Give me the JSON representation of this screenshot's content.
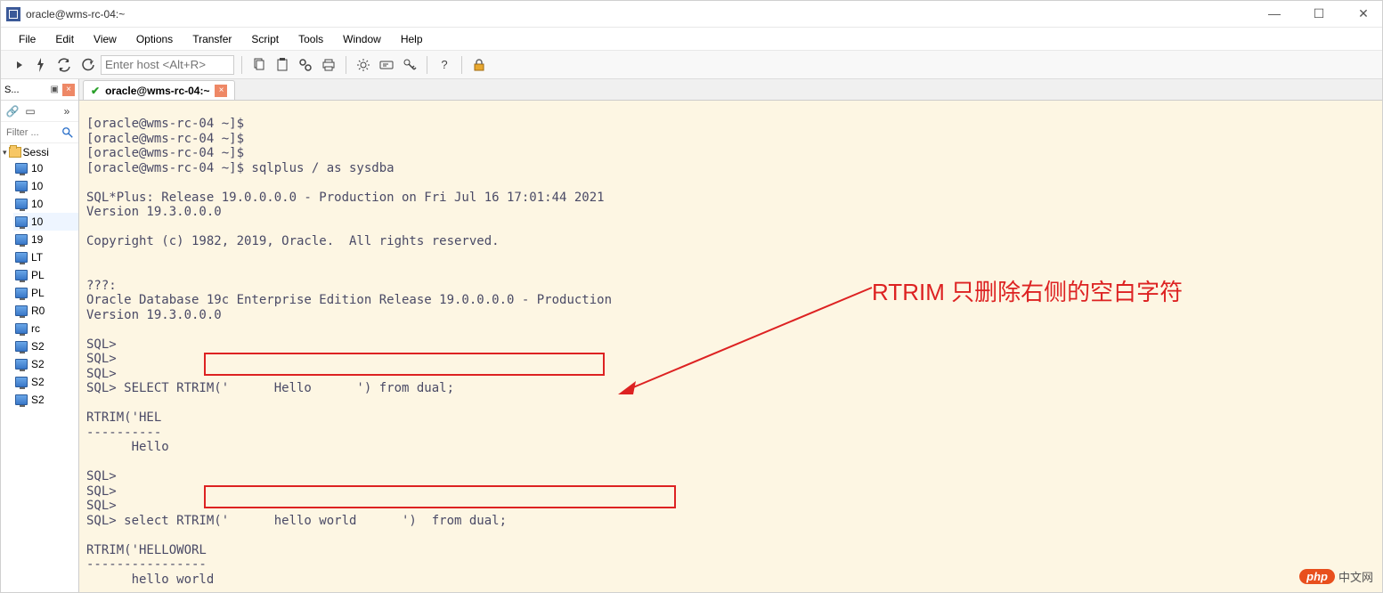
{
  "titlebar": {
    "title": "oracle@wms-rc-04:~"
  },
  "menu": {
    "file": "File",
    "edit": "Edit",
    "view": "View",
    "options": "Options",
    "transfer": "Transfer",
    "script": "Script",
    "tools": "Tools",
    "window": "Window",
    "help": "Help"
  },
  "toolbar": {
    "host_placeholder": "Enter host <Alt+R>"
  },
  "sidebar": {
    "tab_label": "S...",
    "filter_placeholder": "Filter ...",
    "root_label": "Sessi",
    "items": [
      {
        "label": "10"
      },
      {
        "label": "10"
      },
      {
        "label": "10"
      },
      {
        "label": "10"
      },
      {
        "label": "19"
      },
      {
        "label": "LT"
      },
      {
        "label": "PL"
      },
      {
        "label": "PL"
      },
      {
        "label": "R0"
      },
      {
        "label": "rc"
      },
      {
        "label": "S2"
      },
      {
        "label": "S2"
      },
      {
        "label": "S2"
      },
      {
        "label": "S2"
      }
    ],
    "selected_index": 3
  },
  "tab": {
    "title": "oracle@wms-rc-04:~"
  },
  "terminal": {
    "lines": [
      "[oracle@wms-rc-04 ~]$",
      "[oracle@wms-rc-04 ~]$",
      "[oracle@wms-rc-04 ~]$",
      "[oracle@wms-rc-04 ~]$ sqlplus / as sysdba",
      "",
      "SQL*Plus: Release 19.0.0.0.0 - Production on Fri Jul 16 17:01:44 2021",
      "Version 19.3.0.0.0",
      "",
      "Copyright (c) 1982, 2019, Oracle.  All rights reserved.",
      "",
      "",
      "???:",
      "Oracle Database 19c Enterprise Edition Release 19.0.0.0.0 - Production",
      "Version 19.3.0.0.0",
      "",
      "SQL>",
      "SQL>",
      "SQL>",
      "SQL> SELECT RTRIM('      Hello      ') from dual;",
      "",
      "RTRIM('HEL",
      "----------",
      "      Hello",
      "",
      "SQL>",
      "SQL>",
      "SQL>",
      "SQL> select RTRIM('      hello world      ')  from dual;",
      "",
      "RTRIM('HELLOWORL",
      "----------------",
      "      hello world",
      ""
    ]
  },
  "annotation": {
    "text": "RTRIM 只删除右侧的空白字符"
  },
  "watermark": {
    "pill": "php",
    "text": "中文网"
  }
}
